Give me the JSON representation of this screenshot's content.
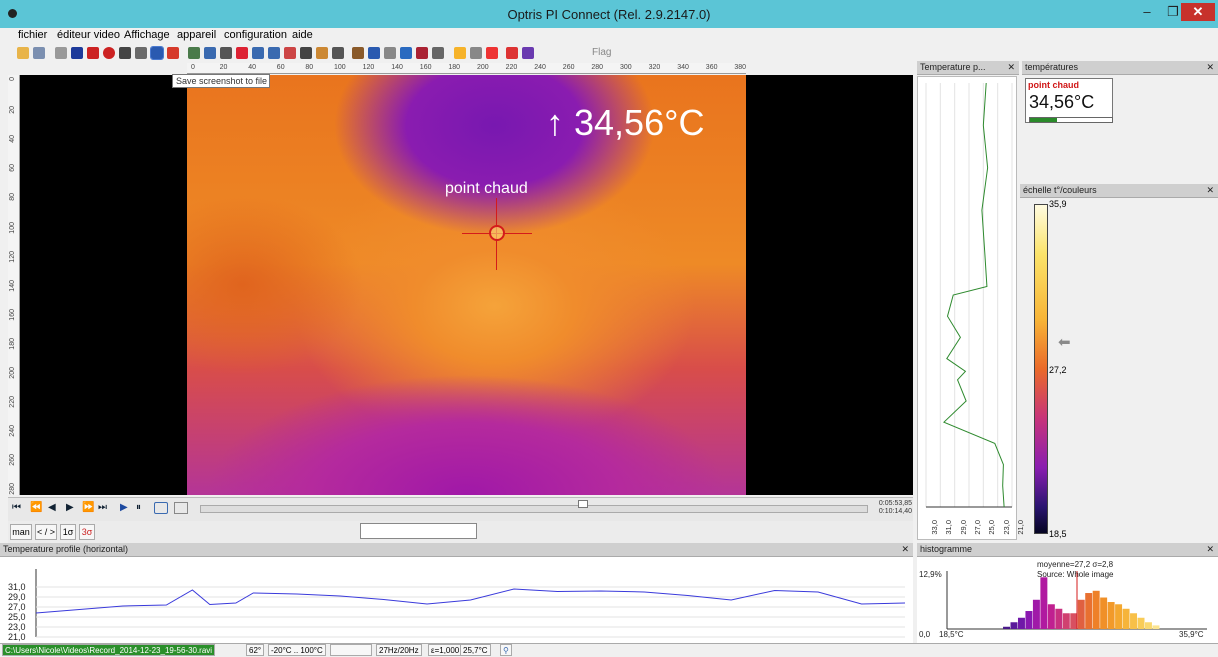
{
  "window": {
    "title": "Optris PI Connect (Rel. 2.9.2147.0)",
    "min_glyph": "–",
    "max_glyph": "❐",
    "close_glyph": "✕"
  },
  "menu": {
    "items": [
      "fichier",
      "éditeur video",
      "Affichage",
      "appareil",
      "configuration",
      "aide"
    ]
  },
  "toolbar": {
    "flag_label": "Flag",
    "tooltip": "Save screenshot to file"
  },
  "ruler": {
    "top_ticks": [
      "0",
      "20",
      "40",
      "60",
      "80",
      "100",
      "120",
      "140",
      "160",
      "180",
      "200",
      "220",
      "240",
      "260",
      "280",
      "300",
      "320",
      "340",
      "360",
      "380"
    ],
    "left_ticks": [
      "0",
      "20",
      "40",
      "60",
      "80",
      "100",
      "120",
      "140",
      "160",
      "180",
      "200",
      "220",
      "240",
      "260",
      "280"
    ]
  },
  "image": {
    "hot_temperature": "↑ 34,56°C",
    "hotspot_label": "point chaud"
  },
  "playback": {
    "first": "⏮",
    "rewind": "⏪",
    "step_back": "◀",
    "step_forward": "▶",
    "fast_forward": "⏩",
    "last": "⏭",
    "play": "▶",
    "pause": "⏸",
    "position_time": "0:05:53,85",
    "total_time": "0:10:14,40",
    "position_fraction": 0.573
  },
  "range_buttons": {
    "man": "man",
    "range": "< / >",
    "one_sigma": "1σ",
    "three_sigma": "3σ"
  },
  "panels": {
    "vprofile_title": "Temperature p...",
    "temps_title": "températures",
    "scale_title": "échelle t°/couleurs",
    "hprofile_title": "Temperature profile (horizontal)",
    "hist_title": "histogramme",
    "pin_glyph": "⊓",
    "close_glyph": "✕"
  },
  "temperature_box": {
    "label": "point chaud",
    "value": "34,56°C",
    "level_fraction": 0.33
  },
  "color_scale": {
    "max": "35,9",
    "mid": "27,2",
    "min": "18,5",
    "arrow_glyph": "⬅"
  },
  "chart_data": [
    {
      "type": "line",
      "title": "Temperature profile (horizontal)",
      "xlabel": "",
      "ylabel": "",
      "y_tick_labels": [
        "31,0",
        "29,0",
        "27,0",
        "25,0",
        "23,0",
        "21,0"
      ],
      "ylim": [
        21,
        33
      ],
      "grid": true,
      "x": [
        0,
        5,
        10,
        15,
        18,
        20,
        23,
        25,
        30,
        35,
        40,
        45,
        50,
        55,
        60,
        65,
        70,
        75,
        80,
        85,
        90,
        95,
        100
      ],
      "series": [
        {
          "color": "#3a3adb",
          "values": [
            25.8,
            26.5,
            27.2,
            27.4,
            30.4,
            27.5,
            27.8,
            29.8,
            29.6,
            29.2,
            28.5,
            27.6,
            28.4,
            30.6,
            30.1,
            30.2,
            30.0,
            29.3,
            28.4,
            30.3,
            30.0,
            27.6,
            27.8
          ]
        }
      ]
    },
    {
      "type": "line",
      "title": "Temperature p...",
      "orientation": "vertical",
      "x_tick_labels": [
        "33,0",
        "31,0",
        "29,0",
        "27,0",
        "25,0",
        "23,0",
        "21,0"
      ],
      "xlim": [
        21,
        33
      ],
      "grid": true,
      "y": [
        0,
        10,
        20,
        30,
        40,
        48,
        50,
        55,
        60,
        65,
        68,
        70,
        75,
        80,
        85,
        90,
        95,
        100
      ],
      "series": [
        {
          "color": "#2e8a2e",
          "values": [
            24.6,
            25.0,
            24.4,
            25.2,
            24.8,
            24.5,
            29.2,
            30.0,
            28.2,
            30.1,
            27.5,
            28.6,
            27.4,
            30.5,
            23.4,
            22.2,
            22.3,
            22.1
          ]
        }
      ]
    },
    {
      "type": "bar",
      "title": "histogramme",
      "stats": "moyenne=27,2 σ=2,8",
      "source": "Source:  Whole image",
      "y_max_label": "12,9%",
      "y_zero_label": "0,0",
      "x_min_label": "18,5°C",
      "x_max_label": "35,9°C",
      "xlim": [
        18.5,
        35.9
      ],
      "ylim": [
        0,
        12.9
      ],
      "marker_value": 27.2,
      "categories": [
        22.5,
        23.0,
        23.5,
        24.0,
        24.5,
        25.0,
        25.5,
        26.0,
        26.5,
        27.0,
        27.5,
        28.0,
        28.5,
        29.0,
        29.5,
        30.0,
        30.5,
        31.0,
        31.5,
        32.0,
        32.5
      ],
      "values": [
        0.5,
        1.5,
        2.5,
        4.0,
        6.5,
        11.5,
        5.5,
        4.5,
        3.5,
        3.5,
        6.5,
        8.0,
        8.5,
        7.0,
        6.0,
        5.5,
        4.5,
        3.5,
        2.5,
        1.5,
        0.8
      ]
    }
  ],
  "status": {
    "path": "C:\\Users\\Nicole\\Videos\\Record_2014-12-23_19-56-30.ravi",
    "fov": "62°",
    "range": "-20°C .. 100°C",
    "empty": "",
    "framerate": "27Hz/20Hz",
    "emissivity": "ε=1,000",
    "ambient": "25,7°C"
  },
  "colors": {
    "titlebar": "#5bc5d6",
    "close_button": "#c7312b",
    "profile_line": "#3a3adb",
    "vprofile_line": "#2e8a2e",
    "hotspot_marker": "#d41b1b",
    "path_status": "#2a8f2a"
  }
}
